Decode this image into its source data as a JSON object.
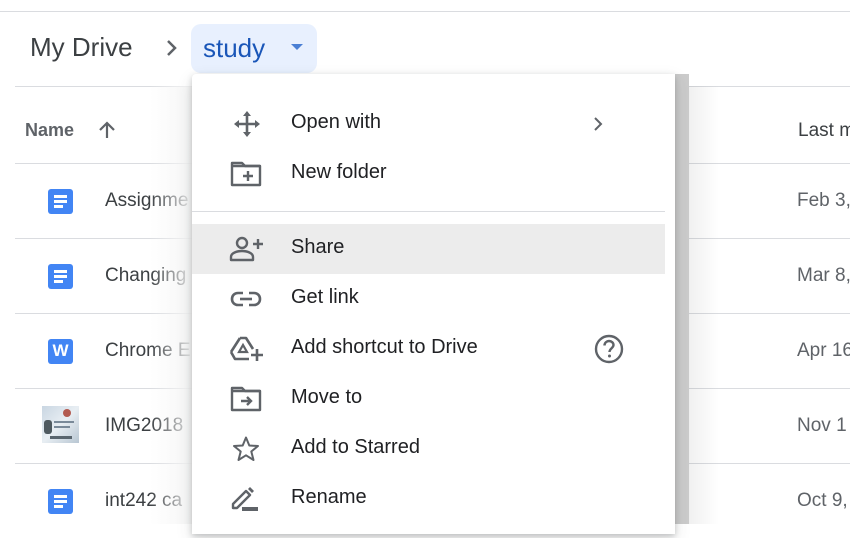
{
  "breadcrumb": {
    "root": "My Drive",
    "current": "study"
  },
  "file_list": {
    "columns": {
      "name": "Name",
      "last_modified": "Last m"
    },
    "sort": "ascending",
    "rows": [
      {
        "icon": "google-docs-icon",
        "name": "Assignme",
        "date": "Feb 3,"
      },
      {
        "icon": "google-docs-icon",
        "name": "Changing",
        "date": "Mar 8,"
      },
      {
        "icon": "word-icon",
        "icon_letter": "W",
        "name": "Chrome E",
        "date": "Apr 16"
      },
      {
        "icon": "image-thumbnail",
        "name": "IMG2018",
        "date": "Nov 1"
      },
      {
        "icon": "google-docs-icon",
        "name": "int242 ca",
        "date": "Oct 9,"
      }
    ]
  },
  "context_menu": {
    "items": [
      {
        "label": "Open with",
        "icon": "open-with-icon",
        "submenu": true
      },
      {
        "label": "New folder",
        "icon": "new-folder-icon"
      },
      {
        "label": "Share",
        "icon": "add-person-icon",
        "highlighted": true
      },
      {
        "label": "Get link",
        "icon": "link-icon"
      },
      {
        "label": "Add shortcut to Drive",
        "icon": "add-shortcut-icon",
        "help": true
      },
      {
        "label": "Move to",
        "icon": "move-to-folder-icon"
      },
      {
        "label": "Add to Starred",
        "icon": "star-icon"
      },
      {
        "label": "Rename",
        "icon": "pencil-icon"
      }
    ]
  },
  "colors": {
    "accent": "#1a56b8",
    "breadcrumb_bg": "#e8f0fe",
    "docs_blue": "#4285f4",
    "menu_hover": "#ececec",
    "icon_gray": "#5f6368"
  }
}
